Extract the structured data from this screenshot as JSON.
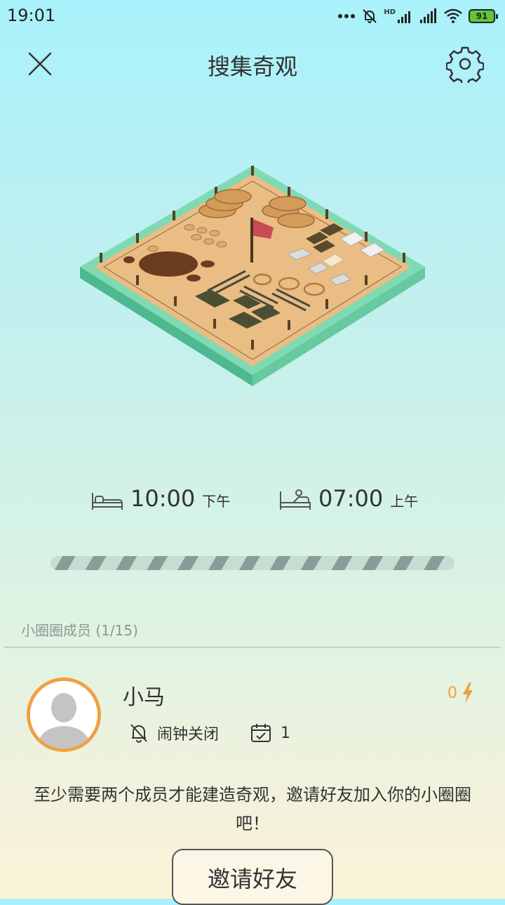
{
  "status_bar": {
    "time": "19:01",
    "network_label": "HD",
    "battery": "91",
    "icons": [
      "dots-icon",
      "mute-bell-icon",
      "signal-icon",
      "signal-icon",
      "wifi-icon",
      "battery-icon"
    ]
  },
  "header": {
    "title": "搜集奇观",
    "close_icon": "close-icon",
    "settings_icon": "gear-icon"
  },
  "schedule": {
    "sleep": {
      "time": "10:00",
      "ampm": "下午",
      "icon": "bed-icon"
    },
    "wake": {
      "time": "07:00",
      "ampm": "上午",
      "icon": "wake-up-icon"
    }
  },
  "members": {
    "label": "小圈圈成员 (1/15)",
    "list": [
      {
        "name": "小马",
        "energy": "0",
        "alarm_status": "闹钟关闭",
        "streak": "1"
      }
    ]
  },
  "notice": "至少需要两个成员才能建造奇观，邀请好友加入你的小圈圈吧！",
  "invite_button": "邀请好友",
  "colors": {
    "accent_orange": "#f0a043",
    "island_green": "#6fcfa4",
    "sand": "#e9bd83"
  }
}
